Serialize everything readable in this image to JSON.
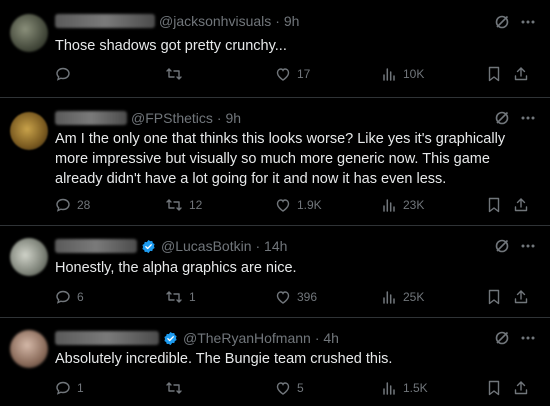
{
  "tweets": [
    {
      "handle": "@jacksonhvisuals",
      "time": "· 9h",
      "text": "Those shadows got pretty crunchy...",
      "verified": false,
      "stats": {
        "replies": "",
        "retweets": "",
        "likes": "17",
        "views": "10K"
      }
    },
    {
      "handle": "@FPSthetics",
      "time": "· 9h",
      "text": "Am I the only one that thinks this looks worse? Like yes it's graphically more impressive but visually so much more generic now. This game already didn't have a lot going for it and now it has even less.",
      "verified": false,
      "stats": {
        "replies": "28",
        "retweets": "12",
        "likes": "1.9K",
        "views": "23K"
      }
    },
    {
      "handle": "@LucasBotkin",
      "time": "· 14h",
      "text": "Honestly, the alpha graphics are nice.",
      "verified": true,
      "stats": {
        "replies": "6",
        "retweets": "1",
        "likes": "396",
        "views": "25K"
      }
    },
    {
      "handle": "@TheRyanHofmann",
      "time": "· 4h",
      "text": "Absolutely incredible. The Bungie team crushed this.",
      "verified": true,
      "stats": {
        "replies": "1",
        "retweets": "",
        "likes": "5",
        "views": "1.5K"
      }
    }
  ],
  "colors": {
    "background": "#000000",
    "text": "#e7e9ea",
    "muted": "#71767b",
    "divider": "#2f3336",
    "verified": "#1d9bf0"
  }
}
